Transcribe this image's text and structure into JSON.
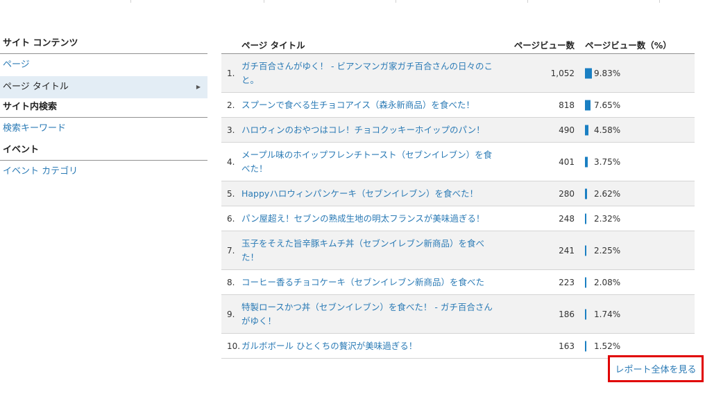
{
  "sidebar": {
    "sections": [
      {
        "header": "サイト コンテンツ",
        "items": [
          "ページ",
          "ページ タイトル"
        ]
      },
      {
        "header": "サイト内検索",
        "items": [
          "検索キーワード"
        ]
      },
      {
        "header": "イベント",
        "items": [
          "イベント カテゴリ"
        ]
      }
    ],
    "active_item": "ページ タイトル"
  },
  "table": {
    "headers": {
      "title": "ページ タイトル",
      "views": "ページビュー数",
      "percent": "ページビュー数（%）"
    },
    "rows": [
      {
        "num": "1.",
        "title": "ガチ百合さんがゆく！ - ビアンマンガ家ガチ百合さんの日々のこと。",
        "views": "1,052",
        "percent": "9.83%",
        "pct_value": 9.83
      },
      {
        "num": "2.",
        "title": "スプーンで食べる生チョコアイス（森永新商品）を食べた！",
        "views": "818",
        "percent": "7.65%",
        "pct_value": 7.65
      },
      {
        "num": "3.",
        "title": "ハロウィンのおやつはコレ！チョコクッキーホイップのパン！",
        "views": "490",
        "percent": "4.58%",
        "pct_value": 4.58
      },
      {
        "num": "4.",
        "title": "メープル味のホイップフレンチトースト（セブンイレブン）を食べた！",
        "views": "401",
        "percent": "3.75%",
        "pct_value": 3.75
      },
      {
        "num": "5.",
        "title": "Happyハロウィンパンケーキ（セブンイレブン）を食べた！",
        "views": "280",
        "percent": "2.62%",
        "pct_value": 2.62
      },
      {
        "num": "6.",
        "title": "パン屋超え！セブンの熟成生地の明太フランスが美味過ぎる！",
        "views": "248",
        "percent": "2.32%",
        "pct_value": 2.32
      },
      {
        "num": "7.",
        "title": "玉子をそえた旨辛豚キムチ丼（セブンイレブン新商品）を食べた！",
        "views": "241",
        "percent": "2.25%",
        "pct_value": 2.25
      },
      {
        "num": "8.",
        "title": "コーヒー香るチョコケーキ（セブンイレブン新商品）を食べた",
        "views": "223",
        "percent": "2.08%",
        "pct_value": 2.08
      },
      {
        "num": "9.",
        "title": "特製ロースかつ丼（セブンイレブン）を食べた！ - ガチ百合さんがゆく！",
        "views": "186",
        "percent": "1.74%",
        "pct_value": 1.74
      },
      {
        "num": "10.",
        "title": "ガルボボール ひとくちの贅沢が美味過ぎる！",
        "views": "163",
        "percent": "1.52%",
        "pct_value": 1.52
      }
    ]
  },
  "actions": {
    "full_report": "レポート全体を見る"
  },
  "colors": {
    "link": "#2a7ab5",
    "bar": "#1a7fc2",
    "highlight_border": "#e00000",
    "active_bg": "#e3edf5"
  }
}
